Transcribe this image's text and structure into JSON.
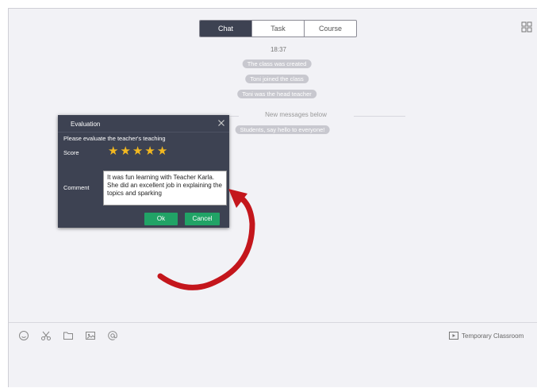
{
  "tabs": [
    {
      "label": "Chat",
      "active": true
    },
    {
      "label": "Task",
      "active": false
    },
    {
      "label": "Course",
      "active": false
    }
  ],
  "chat": {
    "time": "18:37",
    "system_messages": [
      "The class was created",
      "Toni joined the class",
      "Toni was the head teacher"
    ],
    "new_messages_label": "New messages below",
    "after_message": "Students, say hello to everyone!"
  },
  "dialog": {
    "title": "Evaluation",
    "prompt": "Please evaluate the teacher's teaching",
    "score_label": "Score",
    "stars": 5,
    "comment_label": "Comment",
    "comment_text": "It was fun learning with Teacher Karla. She did an excellent job in explaining the topics and sparking",
    "ok_label": "Ok",
    "cancel_label": "Cancel"
  },
  "toolbar": {
    "icons": [
      "emoji-icon",
      "scissors-icon",
      "folder-icon",
      "image-icon",
      "mention-icon"
    ],
    "temporary_classroom_label": "Temporary Classroom"
  },
  "colors": {
    "dialog_bg": "#3d4252",
    "button_green": "#21a366",
    "star_gold": "#f2b820",
    "arrow_red": "#c4161c"
  }
}
